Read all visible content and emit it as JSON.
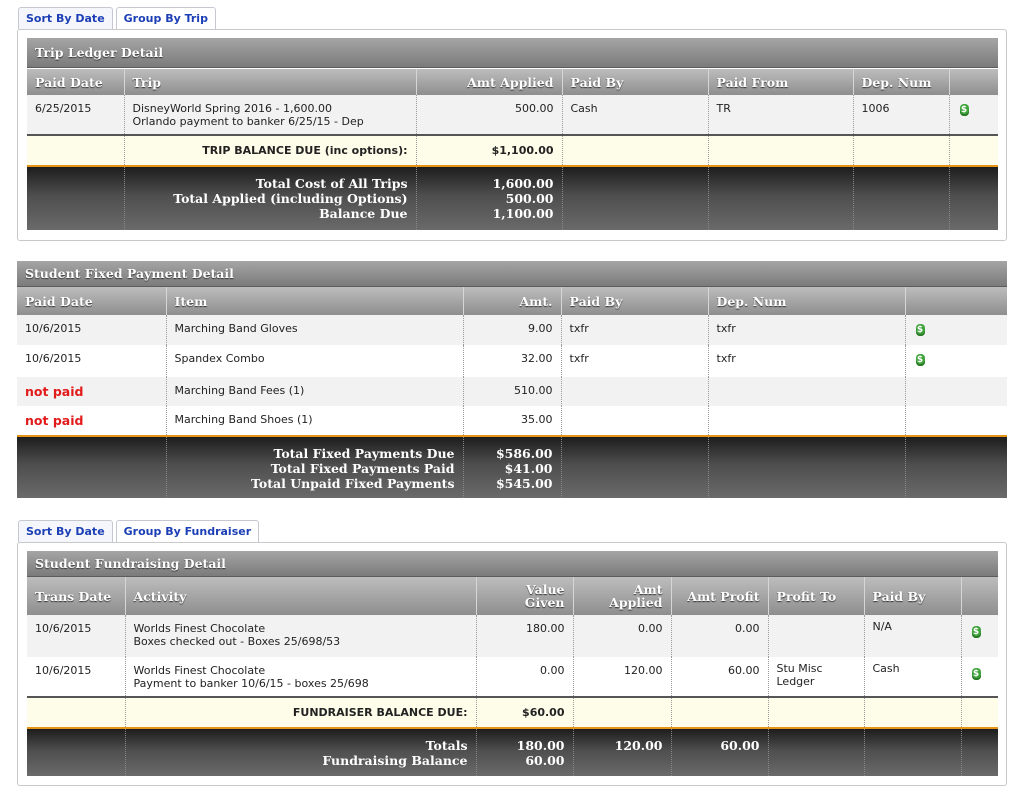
{
  "trip_tabs": {
    "sort_by_date": "Sort By Date",
    "group_by_trip": "Group By Trip"
  },
  "trip_ledger": {
    "title": "Trip Ledger Detail",
    "columns": [
      "Paid Date",
      "Trip",
      "Amt Applied",
      "Paid By",
      "Paid From",
      "Dep. Num",
      ""
    ],
    "rows": [
      {
        "paid_date": "6/25/2015",
        "trip_line1": "DisneyWorld Spring 2016 - 1,600.00",
        "trip_line2": "Orlando payment to banker 6/25/15 - Dep",
        "amt_applied": "500.00",
        "paid_by": "Cash",
        "paid_from": "TR",
        "dep_num": "1006"
      }
    ],
    "balance_label": "TRIP BALANCE DUE (inc options):",
    "balance_value": "$1,100.00",
    "totals_labels": [
      "Total Cost of All Trips",
      "Total Applied (including Options)",
      "Balance Due"
    ],
    "totals_values": [
      "1,600.00",
      "500.00",
      "1,100.00"
    ]
  },
  "fixed_payments": {
    "title": "Student Fixed Payment Detail",
    "columns": [
      "Paid Date",
      "Item",
      "Amt.",
      "Paid By",
      "Dep. Num",
      ""
    ],
    "rows": [
      {
        "paid_date": "10/6/2015",
        "item": "Marching Band Gloves",
        "amt": "9.00",
        "paid_by": "txfr",
        "dep_num": "txfr"
      },
      {
        "paid_date": "10/6/2015",
        "item": "Spandex Combo",
        "amt": "32.00",
        "paid_by": "txfr",
        "dep_num": "txfr"
      },
      {
        "paid_date": "not paid",
        "item": "Marching Band Fees (1)",
        "amt": "510.00",
        "paid_by": "",
        "dep_num": ""
      },
      {
        "paid_date": "not paid",
        "item": "Marching Band Shoes (1)",
        "amt": "35.00",
        "paid_by": "",
        "dep_num": ""
      }
    ],
    "totals_labels": [
      "Total Fixed Payments Due",
      "Total Fixed Payments Paid",
      "Total Unpaid Fixed Payments"
    ],
    "totals_values": [
      "$586.00",
      "$41.00",
      "$545.00"
    ]
  },
  "fund_tabs": {
    "sort_by_date": "Sort By Date",
    "group_by_fundraiser": "Group By Fundraiser"
  },
  "fundraising": {
    "title": "Student Fundraising Detail",
    "columns": [
      "Trans Date",
      "Activity",
      "Value Given",
      "Amt Applied",
      "Amt Profit",
      "Profit To",
      "Paid By",
      ""
    ],
    "col_value_1": "Value",
    "col_value_2": "Given",
    "col_amt_1": "Amt",
    "col_amt_2": "Applied",
    "rows": [
      {
        "date": "10/6/2015",
        "act1": "Worlds Finest Chocolate",
        "act2": "Boxes checked out - Boxes 25/698/53",
        "value": "180.00",
        "applied": "0.00",
        "profit": "0.00",
        "profit_to": "",
        "paid_by": "N/A"
      },
      {
        "date": "10/6/2015",
        "act1": "Worlds Finest Chocolate",
        "act2": "Payment to banker 10/6/15 - boxes 25/698",
        "value": "0.00",
        "applied": "120.00",
        "profit": "60.00",
        "profit_to": "Stu Misc Ledger",
        "paid_by": "Cash"
      }
    ],
    "balance_label": "FUNDRAISER BALANCE DUE:",
    "balance_value": "$60.00",
    "totals_labels": [
      "Totals",
      "Fundraising Balance"
    ],
    "totals_value": [
      "180.00",
      "60.00"
    ],
    "totals_applied": "120.00",
    "totals_profit": "60.00"
  },
  "money_icon_glyph": "$",
  "colors": {
    "accent_orange": "#e59417",
    "not_paid_red": "#e21a1a",
    "money_green": "#3ea33a",
    "tab_blue": "#1c3fb5"
  }
}
